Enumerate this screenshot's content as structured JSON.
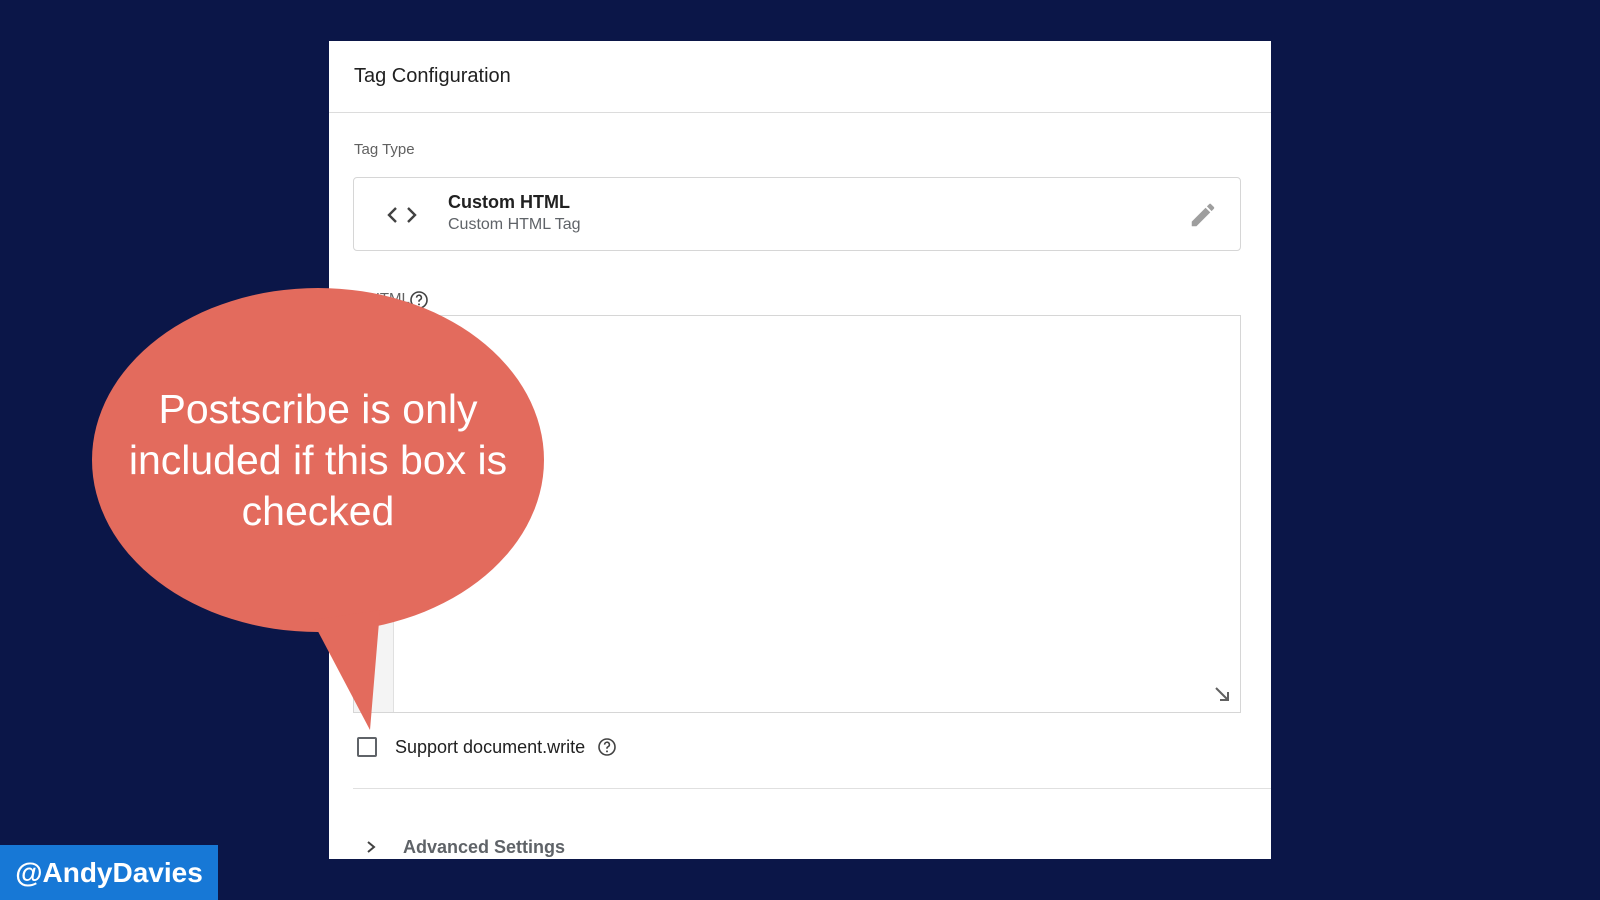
{
  "panel": {
    "title": "Tag Configuration",
    "tag_type_label": "Tag Type",
    "tag_type": {
      "name": "Custom HTML",
      "subtitle": "Custom HTML Tag",
      "icon": "code-icon",
      "edit_icon": "pencil-icon"
    },
    "html_label": "HTML",
    "editor_value": "",
    "checkbox": {
      "label": "Support document.write",
      "checked": false
    },
    "advanced_label": "Advanced Settings"
  },
  "callout": {
    "text": "Postscribe is only included if this box is checked",
    "color": "#e36b5d"
  },
  "footer": {
    "handle": "@AndyDavies",
    "color": "#1778d6"
  },
  "colors": {
    "background": "#0b1648",
    "panel": "#ffffff"
  }
}
